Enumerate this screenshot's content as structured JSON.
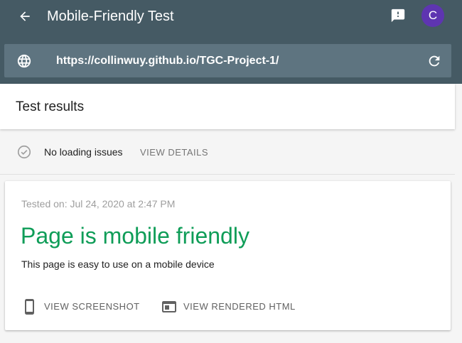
{
  "app": {
    "title": "Mobile-Friendly Test",
    "avatar_initial": "C",
    "accent_color": "#455a64",
    "avatar_color": "#5e35b1",
    "icons": {
      "back": "arrow-left-icon",
      "feedback": "feedback-icon",
      "globe": "globe-icon",
      "refresh": "refresh-icon"
    }
  },
  "url_bar": {
    "url": "https://collinwuy.github.io/TGC-Project-1/"
  },
  "results": {
    "header_title": "Test results",
    "loading_status": "No loading issues",
    "view_details_label": "VIEW DETAILS"
  },
  "card": {
    "tested_on": "Tested on: Jul 24, 2020 at 2:47 PM",
    "verdict": "Page is mobile friendly",
    "verdict_color": "#0f9d58",
    "description": "This page is easy to use on a mobile device",
    "actions": [
      {
        "label": "VIEW SCREENSHOT",
        "icon": "phone-icon"
      },
      {
        "label": "VIEW RENDERED HTML",
        "icon": "browser-window-icon"
      }
    ]
  }
}
